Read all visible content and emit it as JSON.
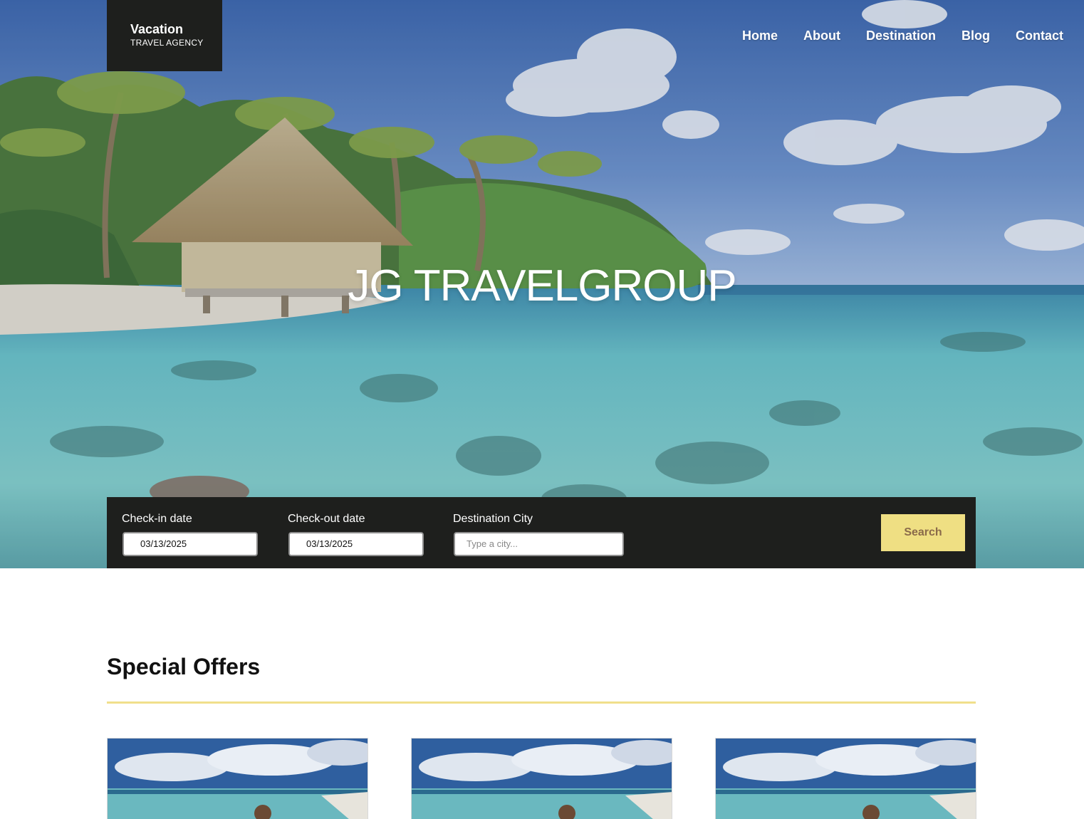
{
  "brand": {
    "title": "Vacation",
    "subtitle": "TRAVEL AGENCY"
  },
  "nav": {
    "items": [
      "Home",
      "About",
      "Destination",
      "Blog",
      "Contact"
    ]
  },
  "hero": {
    "headline": "JG TRAVELGROUP"
  },
  "booking": {
    "checkin_label": "Check-in date",
    "checkin_value": "03/13/2025",
    "checkout_label": "Check-out date",
    "checkout_value": "03/13/2025",
    "city_label": "Destination City",
    "city_placeholder": "Type a city...",
    "search_label": "Search"
  },
  "offers": {
    "title": "Special Offers"
  },
  "colors": {
    "dark": "#1e1f1d",
    "accent": "#efdf83",
    "search_text": "#8a6a4a"
  }
}
